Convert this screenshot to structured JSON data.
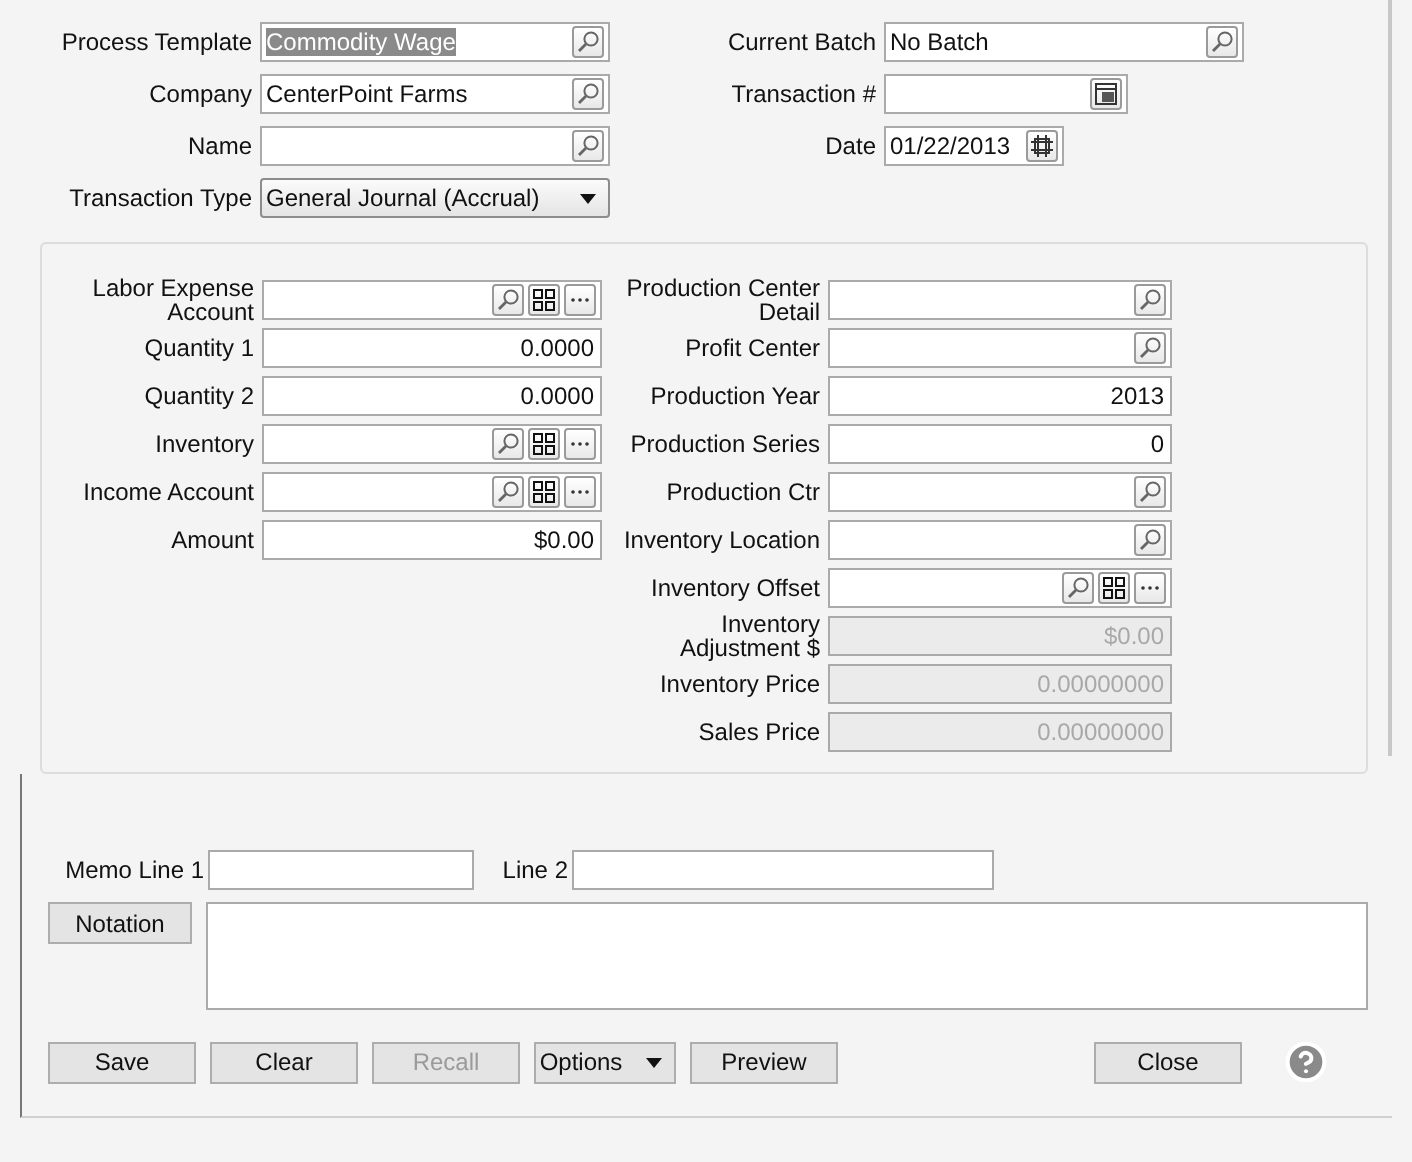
{
  "header": {
    "left": [
      {
        "label": "Process Template",
        "value": "Commodity Wage",
        "kind": "lookup",
        "highlighted": true
      },
      {
        "label": "Company",
        "value": "CenterPoint Farms",
        "kind": "lookup"
      },
      {
        "label": "Name",
        "kind": "lookup"
      },
      {
        "label": "Transaction Type",
        "value": "General Journal (Accrual)",
        "kind": "dropdown"
      }
    ],
    "right": [
      {
        "label": "Current Batch",
        "value": "No Batch",
        "kind": "lookup"
      },
      {
        "label": "Transaction #",
        "kind": "counter"
      },
      {
        "label": "Date",
        "value": "01/22/2013",
        "kind": "date"
      }
    ]
  },
  "details": {
    "left": [
      {
        "label": "Labor Expense Account",
        "kind": "account",
        "disabled": false
      },
      {
        "label": "Quantity 1",
        "value": "0.0000",
        "kind": "number",
        "disabled": false
      },
      {
        "label": "Quantity 2",
        "value": "0.0000",
        "kind": "number",
        "disabled": false
      },
      {
        "label": "Inventory",
        "kind": "account",
        "disabled": false
      },
      {
        "label": "Income Account",
        "kind": "account",
        "disabled": false
      },
      {
        "label": "Amount",
        "value": "$0.00",
        "kind": "number",
        "disabled": false
      }
    ],
    "right": [
      {
        "label": "Production Center Detail",
        "kind": "lookup",
        "disabled": false
      },
      {
        "label": "Profit Center",
        "kind": "lookup",
        "disabled": false
      },
      {
        "label": "Production Year",
        "value": "2013",
        "kind": "number",
        "disabled": false
      },
      {
        "label": "Production Series",
        "value": "0",
        "kind": "number",
        "disabled": false
      },
      {
        "label": "Production Ctr",
        "kind": "lookup",
        "disabled": false
      },
      {
        "label": "Inventory Location",
        "kind": "lookup",
        "disabled": false
      },
      {
        "label": "Inventory Offset",
        "kind": "account",
        "disabled": false
      },
      {
        "label": "Inventory Adjustment $",
        "value": "$0.00",
        "kind": "number",
        "disabled": true
      },
      {
        "label": "Inventory Price",
        "value": "0.00000000",
        "kind": "number",
        "disabled": true
      },
      {
        "label": "Sales Price",
        "value": "0.00000000",
        "kind": "number",
        "disabled": true
      }
    ]
  },
  "memo": {
    "line1_label": "Memo Line 1",
    "line2_label": "Line 2"
  },
  "notation": {
    "button": "Notation"
  },
  "buttons": [
    {
      "label": "Save",
      "kind": "plain",
      "disabled": false
    },
    {
      "label": "Clear",
      "kind": "plain",
      "disabled": false
    },
    {
      "label": "Recall",
      "kind": "plain",
      "disabled": true
    },
    {
      "label": "Options",
      "kind": "menu",
      "disabled": false
    },
    {
      "label": "Preview",
      "kind": "plain",
      "disabled": false
    }
  ],
  "close": {
    "label": "Close",
    "disabled": false
  }
}
